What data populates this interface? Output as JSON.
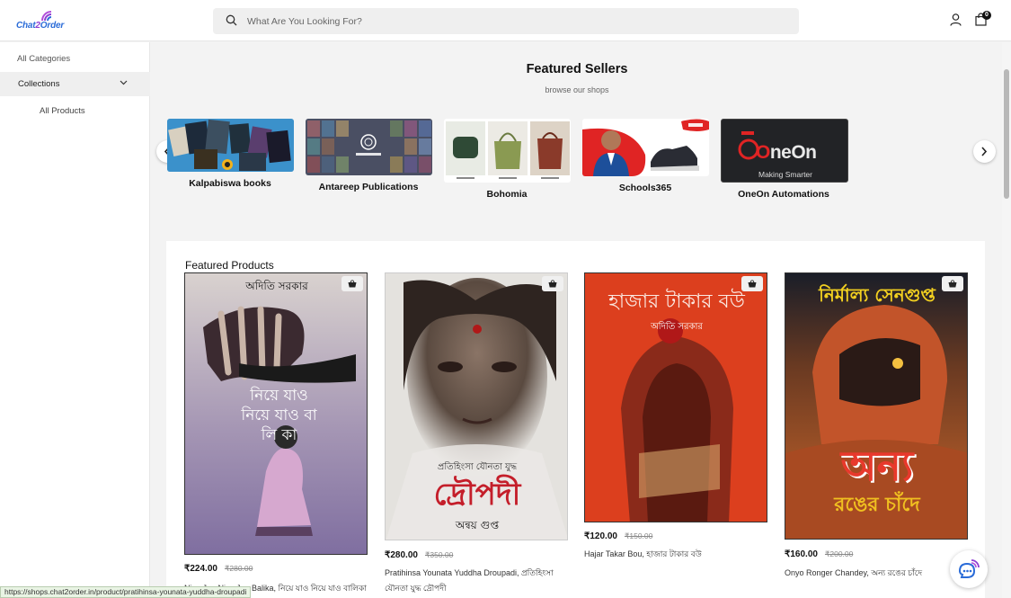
{
  "header": {
    "logo_text_1": "Chat",
    "logo_text_2": "2",
    "logo_text_3": "Order",
    "search_placeholder": "What Are You Looking For?",
    "cart_count": "0"
  },
  "sidebar": {
    "all_categories": "All Categories",
    "collections": "Collections",
    "all_products": "All Products"
  },
  "featured_sellers": {
    "title": "Featured Sellers",
    "subtitle": "browse our shops",
    "sellers": [
      {
        "name": "Kalpabiswa books"
      },
      {
        "name": "Antareep Publications"
      },
      {
        "name": "Bohomia"
      },
      {
        "name": "Schools365"
      },
      {
        "name": "OneOn Automations"
      }
    ],
    "oneon_logo": "OneOn",
    "oneon_tagline": "Making Smarter"
  },
  "featured_products": {
    "title": "Featured Products",
    "products": [
      {
        "price": "₹224.00",
        "old_price": "₹280.00",
        "name": "Niye Jao Niye Jao Balika, নিয়ে যাও নিয়ে যাও বালিকা",
        "cover_title": "নিয়ে যাও নিয়ে যাও বা লি কা",
        "cover_author": "অদিতি সরকার"
      },
      {
        "price": "₹280.00",
        "old_price": "₹350.00",
        "name": "Pratihinsa Younata Yuddha Droupadi, প্রতিহিংসা যৌনতা যুদ্ধ দ্রৌপদী",
        "cover_title": "দ্রৌপদী",
        "cover_author": "অন্বয় গুপ্ত"
      },
      {
        "price": "₹120.00",
        "old_price": "₹150.00",
        "name": "Hajar Takar Bou, হাজার টাকার বউ",
        "cover_title": "হাজার টাকার বউ",
        "cover_author": "অদিতি সরকার"
      },
      {
        "price": "₹160.00",
        "old_price": "₹200.00",
        "name": "Onyo Ronger Chandey, অন্য রঙের চাঁদে",
        "cover_title": "অন্য রঙের চাঁদে",
        "cover_author": "নির্মাল্য সেনগুপ্ত"
      }
    ]
  },
  "status_url": "https://shops.chat2order.in/product/pratihinsa-younata-yuddha-droupadi",
  "colors": {
    "brand_blue": "#2b6cd8",
    "brand_purple": "#8e3fd4"
  }
}
